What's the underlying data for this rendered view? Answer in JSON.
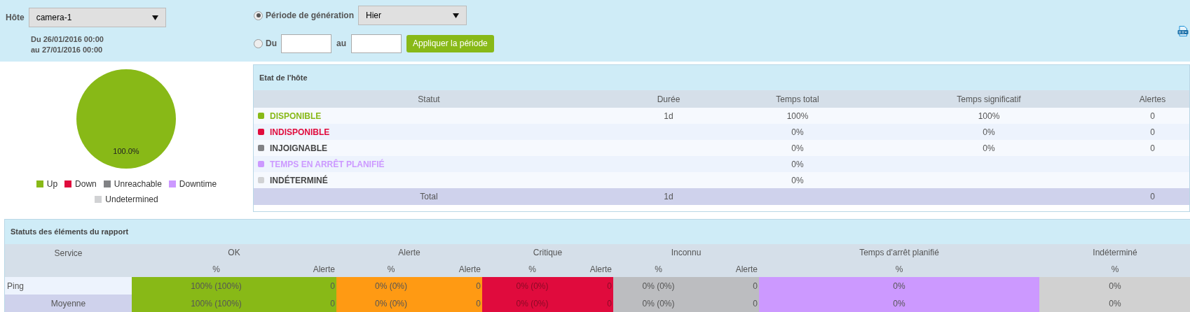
{
  "filters": {
    "host_label": "Hôte",
    "host": "camera-1",
    "date_from": "Du 26/01/2016 00:00",
    "date_to": "au 27/01/2016 00:00",
    "period_options": [
      {
        "kind": "preset",
        "label": "Période de génération",
        "selected": true,
        "value": "Hier"
      },
      {
        "kind": "range",
        "label": "Du",
        "selected": false,
        "to_label": "au"
      }
    ],
    "apply_button": "Appliquer la période"
  },
  "pie": {
    "chart_data": {
      "type": "pie",
      "categories": [
        "Up",
        "Down",
        "Unreachable",
        "Downtime",
        "Undetermined"
      ],
      "values": [
        100,
        0,
        0,
        0,
        0
      ],
      "colors": [
        "#88b917",
        "#e00b3d",
        "#818285",
        "#cc99ff",
        "#d1d2d4"
      ],
      "value_labels": [
        "100.0%",
        null,
        null,
        null,
        null
      ]
    }
  },
  "host_state": {
    "title": "Etat de l'hôte",
    "columns": [
      "Statut",
      "Durée",
      "Temps total",
      "Temps significatif",
      "Alertes"
    ],
    "rows": [
      {
        "status": "DISPONIBLE",
        "color": "#88b917",
        "duration": "1d",
        "total_time": "100%",
        "significant_time": "100%",
        "alerts": "0"
      },
      {
        "status": "INDISPONIBLE",
        "color": "#e00b3d",
        "total_time": "0%",
        "significant_time": "0%",
        "alerts": "0"
      },
      {
        "status": "INJOIGNABLE",
        "color": "#818285",
        "total_time": "0%",
        "significant_time": "0%",
        "alerts": "0"
      },
      {
        "status": "TEMPS EN ARRÊT PLANIFIÉ",
        "color": "#cc99ff",
        "total_time": "0%"
      },
      {
        "status": "INDÉTERMINÉ",
        "color": "#d1d2d4",
        "total_time": "0%"
      }
    ],
    "total": {
      "label": "Total",
      "duration": "1d",
      "alerts": "0"
    }
  },
  "report": {
    "title": "Statuts des éléments du rapport",
    "service_column": "Service",
    "groups": [
      {
        "label": "OK",
        "color": "#88b917",
        "subcolumns": [
          "%",
          "Alerte"
        ]
      },
      {
        "label": "Alerte",
        "color": "#ff9a13",
        "subcolumns": [
          "%",
          "Alerte"
        ]
      },
      {
        "label": "Critique",
        "color": "#e00b3d",
        "subcolumns": [
          "%",
          "Alerte"
        ]
      },
      {
        "label": "Inconnu",
        "color": "#bcbdc0",
        "subcolumns": [
          "%",
          "Alerte"
        ]
      },
      {
        "label": "Temps d'arrêt planifié",
        "color": "#cc99ff",
        "subcolumns": [
          "%"
        ]
      },
      {
        "label": "Indéterminé",
        "color": "#d1d1d1",
        "subcolumns": [
          "%"
        ]
      }
    ],
    "rows": [
      {
        "kind": "service",
        "service": "Ping",
        "cells": [
          "100% (100%)",
          "0",
          "0% (0%)",
          "0",
          "0% (0%)",
          "0",
          "0% (0%)",
          "0",
          "0%",
          "0%"
        ]
      },
      {
        "kind": "average",
        "service": "Moyenne",
        "cells": [
          "100% (100%)",
          "0",
          "0% (0%)",
          "0",
          "0% (0%)",
          "0",
          "0% (0%)",
          "0",
          "0%",
          "0%"
        ]
      }
    ]
  }
}
